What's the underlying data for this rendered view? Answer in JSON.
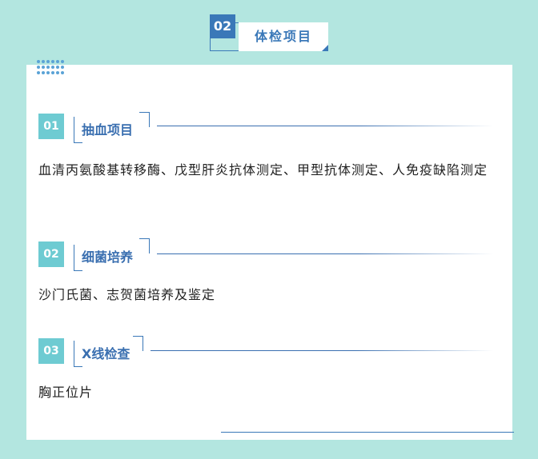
{
  "header": {
    "number": "02",
    "title": "体检项目"
  },
  "sections": [
    {
      "number": "01",
      "title": "抽血项目",
      "text": "血清丙氨酸基转移酶、戊型肝炎抗体测定、甲型抗体测定、人免疫缺陷测定"
    },
    {
      "number": "02",
      "title": "细菌培养",
      "text": "沙门氏菌、志贺菌培养及鉴定"
    },
    {
      "number": "03",
      "title": "X线检查",
      "text": "胸正位片"
    }
  ],
  "colors": {
    "background": "#b3e6e0",
    "accent": "#3a78b8",
    "badge": "#6ecbd2"
  }
}
